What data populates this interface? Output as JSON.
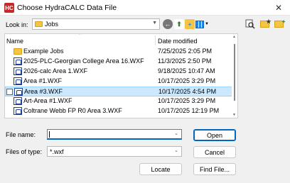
{
  "window": {
    "title": "Choose HydraCALC Data File",
    "app_icon": "HC",
    "close_glyph": "✕"
  },
  "lookin": {
    "label": "Look in:",
    "value": "Jobs"
  },
  "toolbar": {
    "back_icon": "back-arrow-icon",
    "up_icon": "up-folder-icon",
    "new_folder_icon": "new-folder-icon",
    "views_icon": "view-menu-icon"
  },
  "columns": {
    "name": "Name",
    "date": "Date modified"
  },
  "files": [
    {
      "name": "Example Jobs",
      "date": "7/25/2025 2:05 PM",
      "type": "folder"
    },
    {
      "name": "2025-PLC-Georgian College Area 16.WXF",
      "date": "11/3/2025 2:50 PM",
      "type": "file"
    },
    {
      "name": "2026-calc Area 1.WXF",
      "date": "9/18/2025 10:47 AM",
      "type": "file"
    },
    {
      "name": "Area #1.WXF",
      "date": "10/17/2025 3:29 PM",
      "type": "file"
    },
    {
      "name": "Area #3.WXF",
      "date": "10/17/2025 4:54 PM",
      "type": "file",
      "selected": true
    },
    {
      "name": "Art-Area #1.WXF",
      "date": "10/17/2025 3:29 PM",
      "type": "file"
    },
    {
      "name": "Coltrane Webb FP R0 Area 3.WXF",
      "date": "10/17/2025 12:19 PM",
      "type": "file"
    }
  ],
  "filename": {
    "label": "File name:",
    "value": ""
  },
  "filetype": {
    "label": "Files of type:",
    "value": "*.wxf"
  },
  "buttons": {
    "open": "Open",
    "cancel": "Cancel",
    "locate": "Locate",
    "find_file": "Find File..."
  }
}
